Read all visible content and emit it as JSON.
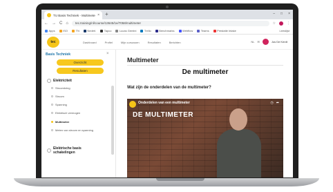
{
  "browser": {
    "tab_title": "TU Basis Techniek - Multimeter",
    "tab_close": "×",
    "new_tab": "+",
    "window_controls": [
      "–",
      "□",
      "×"
    ],
    "nav": [
      "←",
      "→",
      "C",
      "⌂"
    ],
    "url": "tec.training/nl/course/13645/1e/7058/multimeter",
    "bookmarks": [
      "Apps",
      "ISO",
      "TN",
      "Nederl.",
      "Tapco",
      "Lucas Gemini",
      "Trello",
      "Benchmarks",
      "Webflow",
      "Teams",
      "Prestatie Intake",
      "Leeslijst"
    ]
  },
  "site": {
    "logo_text": "tec",
    "nav": [
      "Dashboard",
      "Profiel",
      "Mijn cursussen",
      "Resultaten",
      "Berichten"
    ],
    "lang": "NL",
    "user_name": "Jos De Kerdt"
  },
  "sidebar": {
    "title": "Basis Techniek",
    "close": "×",
    "buttons": [
      "Overzicht",
      "Resultaten"
    ],
    "sections": [
      {
        "label": "Elektriciteit",
        "items": [
          "Stroomkring",
          "Stroom",
          "Spanning",
          "Elektrisch vermogen",
          "Multimeter",
          "Meten van stroom en spanning"
        ]
      },
      {
        "label": "Elektrische basis schakelingen",
        "items": []
      }
    ],
    "active_item": "Multimeter"
  },
  "main": {
    "page_title": "Multimeter",
    "heading": "De multimeter",
    "question": "Wat zijn de onderdelen van de multimeter?"
  },
  "video": {
    "title": "Onderdelen van een multimeter",
    "big_text": "DE MULTIMETER",
    "icons": [
      "watch-later-icon",
      "share-icon"
    ]
  }
}
